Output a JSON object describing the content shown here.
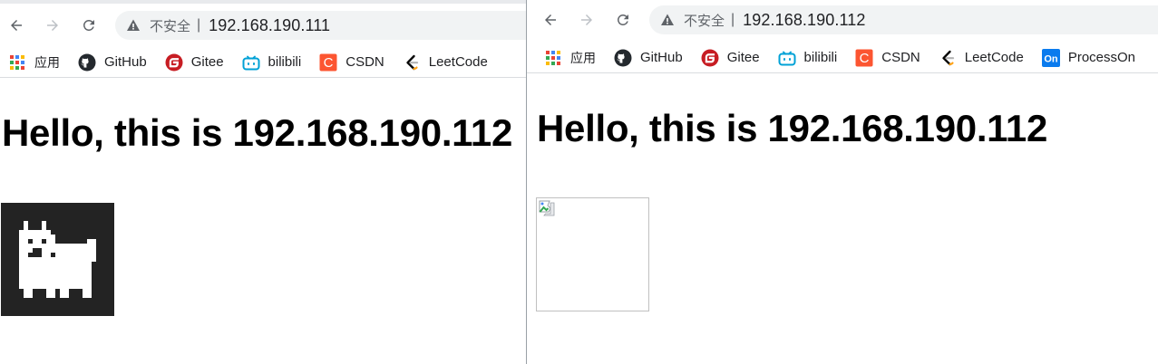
{
  "windows": [
    {
      "id": "left",
      "security_label": "不安全",
      "separator": "|",
      "url": "192.168.190.111",
      "bookmarks": [
        {
          "label": "应用",
          "icon": "apps-grid-icon"
        },
        {
          "label": "GitHub",
          "icon": "github-icon"
        },
        {
          "label": "Gitee",
          "icon": "gitee-icon"
        },
        {
          "label": "bilibili",
          "icon": "bilibili-icon"
        },
        {
          "label": "CSDN",
          "icon": "csdn-icon"
        },
        {
          "label": "LeetCode",
          "icon": "leetcode-icon"
        }
      ],
      "heading": "Hello, this is 192.168.190.112",
      "image": "pixel-dog-image"
    },
    {
      "id": "right",
      "security_label": "不安全",
      "separator": "|",
      "url": "192.168.190.112",
      "bookmarks": [
        {
          "label": "应用",
          "icon": "apps-grid-icon"
        },
        {
          "label": "GitHub",
          "icon": "github-icon"
        },
        {
          "label": "Gitee",
          "icon": "gitee-icon"
        },
        {
          "label": "bilibili",
          "icon": "bilibili-icon"
        },
        {
          "label": "CSDN",
          "icon": "csdn-icon"
        },
        {
          "label": "LeetCode",
          "icon": "leetcode-icon"
        },
        {
          "label": "ProcessOn",
          "icon": "processon-icon"
        }
      ],
      "heading": "Hello, this is 192.168.190.112",
      "image": "broken-image-icon"
    }
  ],
  "icon_glyphs": {
    "csdn": "C",
    "processon": "On"
  },
  "colors": {
    "gitee": "#c71d23",
    "bilibili": "#00a1d6",
    "csdn": "#fc5531",
    "processon": "#0a7bee",
    "leetcode_orange": "#ffa116",
    "omnibox": "#f1f3f4"
  }
}
